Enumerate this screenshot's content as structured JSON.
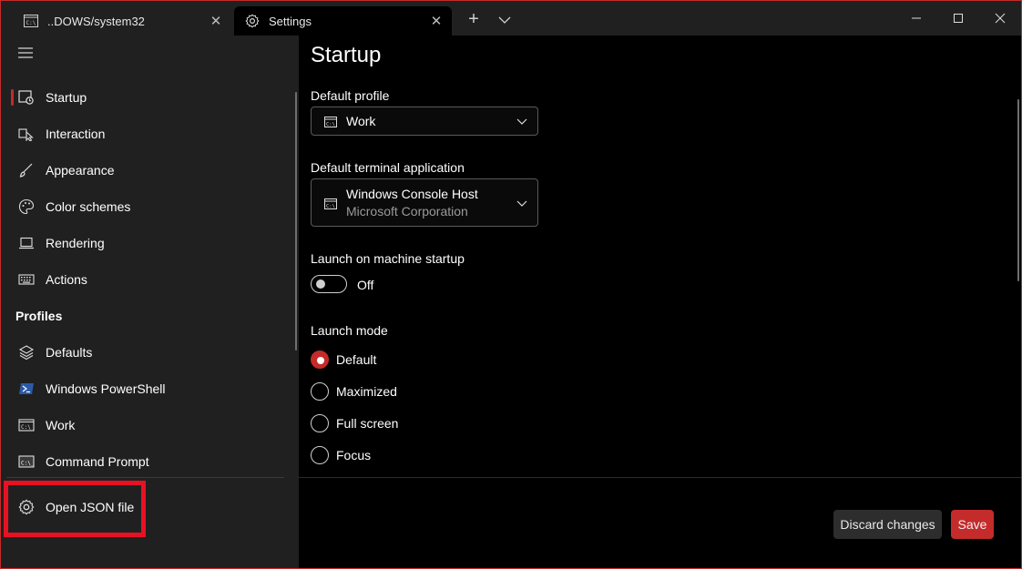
{
  "colors": {
    "accent": "#c42b2b",
    "highlight": "#e81123",
    "background": "#000000",
    "sidebar": "#202020"
  },
  "tabs": [
    {
      "title": "..DOWS/system32",
      "icon": "cmd-icon",
      "active": false
    },
    {
      "title": "Settings",
      "icon": "gear-icon",
      "active": true
    }
  ],
  "sidebar": {
    "items": [
      {
        "label": "Startup",
        "icon": "startup-icon",
        "selected": true
      },
      {
        "label": "Interaction",
        "icon": "interaction-icon"
      },
      {
        "label": "Appearance",
        "icon": "paintbrush-icon"
      },
      {
        "label": "Color schemes",
        "icon": "palette-icon"
      },
      {
        "label": "Rendering",
        "icon": "laptop-icon"
      },
      {
        "label": "Actions",
        "icon": "keyboard-icon"
      }
    ],
    "profiles_header": "Profiles",
    "profiles": [
      {
        "label": "Defaults",
        "icon": "layers-icon"
      },
      {
        "label": "Windows PowerShell",
        "icon": "powershell-icon"
      },
      {
        "label": "Work",
        "icon": "terminal-icon"
      },
      {
        "label": "Command Prompt",
        "icon": "cmd-icon"
      }
    ],
    "open_json": {
      "label": "Open JSON file",
      "icon": "gear-icon"
    }
  },
  "page": {
    "title": "Startup",
    "default_profile": {
      "label": "Default profile",
      "value": "Work"
    },
    "default_terminal": {
      "label": "Default terminal application",
      "value": "Windows Console Host",
      "sub": "Microsoft Corporation"
    },
    "launch_on_startup": {
      "label": "Launch on machine startup",
      "state": "Off"
    },
    "launch_mode": {
      "label": "Launch mode",
      "options": [
        "Default",
        "Maximized",
        "Full screen",
        "Focus"
      ],
      "selected": "Default"
    }
  },
  "footer": {
    "discard_label": "Discard changes",
    "save_label": "Save"
  }
}
